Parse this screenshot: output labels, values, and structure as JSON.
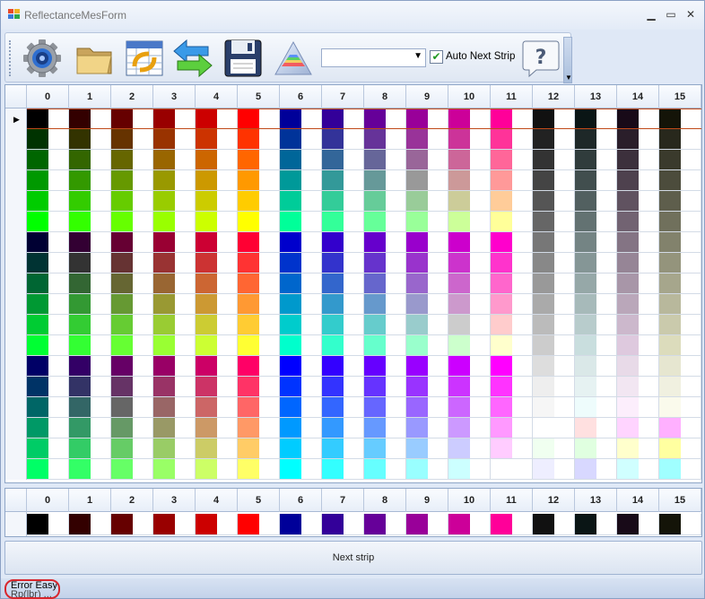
{
  "window": {
    "title": "ReflectanceMesForm",
    "minimize": "▁",
    "maximize": "▭",
    "close": "✕"
  },
  "toolbar": {
    "buttons": [
      {
        "name": "settings-button",
        "icon": "gear-icon"
      },
      {
        "name": "open-folder-button",
        "icon": "folder-icon"
      },
      {
        "name": "table-button",
        "icon": "spreadsheet-refresh-icon"
      },
      {
        "name": "transfer-button",
        "icon": "swap-arrows-icon"
      },
      {
        "name": "save-button",
        "icon": "floppy-disk-icon"
      },
      {
        "name": "prism-button",
        "icon": "prism-icon"
      }
    ],
    "strip_select_value": "",
    "strip_select_arrow": "▼",
    "auto_next_strip_label": "Auto Next Strip",
    "auto_next_strip_checked": true,
    "check_mark": "✔",
    "help_icon": "question-bubble-icon",
    "help_label": "?"
  },
  "grid": {
    "columns": [
      "0",
      "1",
      "2",
      "3",
      "4",
      "5",
      "6",
      "7",
      "8",
      "9",
      "10",
      "11",
      "12",
      "13",
      "14",
      "15"
    ],
    "rows": [
      [
        "#000000",
        "#330000",
        "#660000",
        "#990000",
        "#cc0000",
        "#ff0000",
        "#000099",
        "#330099",
        "#660099",
        "#990099",
        "#cc0099",
        "#ff0099",
        "#111111",
        "#0a1515",
        "#180a18",
        "#141408"
      ],
      [
        "#003300",
        "#333300",
        "#663300",
        "#993300",
        "#cc3300",
        "#ff3300",
        "#003399",
        "#333399",
        "#663399",
        "#993399",
        "#cc3399",
        "#ff3399",
        "#222222",
        "#1e2828",
        "#2a1e2a",
        "#28281c"
      ],
      [
        "#006600",
        "#336600",
        "#666600",
        "#996600",
        "#cc6600",
        "#ff6600",
        "#006699",
        "#336699",
        "#666699",
        "#996699",
        "#cc6699",
        "#ff6699",
        "#333333",
        "#303c3c",
        "#3c303c",
        "#3a3a2c"
      ],
      [
        "#009900",
        "#339900",
        "#669900",
        "#999900",
        "#cc9900",
        "#ff9900",
        "#009999",
        "#339999",
        "#669999",
        "#999999",
        "#cc9999",
        "#ff9999",
        "#444444",
        "#414e4e",
        "#4e414e",
        "#4c4c3c"
      ],
      [
        "#00cc00",
        "#33cc00",
        "#66cc00",
        "#99cc00",
        "#cccc00",
        "#ffcc00",
        "#00cc99",
        "#33cc99",
        "#66cc99",
        "#99cc99",
        "#cccc99",
        "#ffcc99",
        "#555555",
        "#526060",
        "#605260",
        "#5e5e4c"
      ],
      [
        "#00ff00",
        "#33ff00",
        "#66ff00",
        "#99ff00",
        "#ccff00",
        "#ffff00",
        "#00ff99",
        "#33ff99",
        "#66ff99",
        "#99ff99",
        "#ccff99",
        "#ffff99",
        "#666666",
        "#637272",
        "#726372",
        "#70705c"
      ],
      [
        "#000033",
        "#330033",
        "#660033",
        "#990033",
        "#cc0033",
        "#ff0033",
        "#0000cc",
        "#3300cc",
        "#6600cc",
        "#9900cc",
        "#cc00cc",
        "#ff00cc",
        "#777777",
        "#748484",
        "#847484",
        "#82826c"
      ],
      [
        "#003333",
        "#333333",
        "#663333",
        "#993333",
        "#cc3333",
        "#ff3333",
        "#0033cc",
        "#3333cc",
        "#6633cc",
        "#9933cc",
        "#cc33cc",
        "#ff33cc",
        "#888888",
        "#859696",
        "#968596",
        "#94947c"
      ],
      [
        "#006633",
        "#336633",
        "#666633",
        "#996633",
        "#cc6633",
        "#ff6633",
        "#0066cc",
        "#3366cc",
        "#6666cc",
        "#9966cc",
        "#cc66cc",
        "#ff66cc",
        "#999999",
        "#96a8a8",
        "#a896a8",
        "#a6a68c"
      ],
      [
        "#009933",
        "#339933",
        "#669933",
        "#999933",
        "#cc9933",
        "#ff9933",
        "#0099cc",
        "#3399cc",
        "#6699cc",
        "#9999cc",
        "#cc99cc",
        "#ff99cc",
        "#aaaaaa",
        "#a7baba",
        "#baa7ba",
        "#b8b89c"
      ],
      [
        "#00cc33",
        "#33cc33",
        "#66cc33",
        "#99cc33",
        "#cccc33",
        "#ffcc33",
        "#00cccc",
        "#33cccc",
        "#66cccc",
        "#99cccc",
        "#cccccc",
        "#ffcccc",
        "#bbbbbb",
        "#b8cccc",
        "#ccb8cc",
        "#cacaac"
      ],
      [
        "#00ff33",
        "#33ff33",
        "#66ff33",
        "#99ff33",
        "#ccff33",
        "#ffff33",
        "#00ffcc",
        "#33ffcc",
        "#66ffcc",
        "#99ffcc",
        "#ccffcc",
        "#ffffcc",
        "#cccccc",
        "#c9dede",
        "#dec9de",
        "#dcdcbc"
      ],
      [
        "#000066",
        "#330066",
        "#660066",
        "#990066",
        "#cc0066",
        "#ff0066",
        "#0000ff",
        "#3300ff",
        "#6600ff",
        "#9900ff",
        "#cc00ff",
        "#ff00ff",
        "#dddddd",
        "#dae8e8",
        "#e8dae8",
        "#e6e6d0"
      ],
      [
        "#003366",
        "#333366",
        "#663366",
        "#993366",
        "#cc3366",
        "#ff3366",
        "#0033ff",
        "#3333ff",
        "#6633ff",
        "#9933ff",
        "#cc33ff",
        "#ff33ff",
        "#eeeeee",
        "#e6f2f2",
        "#f2e6f2",
        "#f0f0e0"
      ],
      [
        "#006666",
        "#336666",
        "#666666",
        "#996666",
        "#cc6666",
        "#ff6666",
        "#0066ff",
        "#3366ff",
        "#6666ff",
        "#9966ff",
        "#cc66ff",
        "#ff66ff",
        "#f6f6f6",
        "#eefcfc",
        "#fceefc",
        "#fafaec"
      ],
      [
        "#009966",
        "#339966",
        "#669966",
        "#999966",
        "#cc9966",
        "#ff9966",
        "#0099ff",
        "#3399ff",
        "#6699ff",
        "#9999ff",
        "#cc99ff",
        "#ff99ff",
        "#ffffff",
        "#ffe0e0",
        "#ffd4ff",
        "#ffb0ff"
      ],
      [
        "#00cc66",
        "#33cc66",
        "#66cc66",
        "#99cc66",
        "#cccc66",
        "#ffcc66",
        "#00ccff",
        "#33ccff",
        "#66ccff",
        "#99ccff",
        "#ccccff",
        "#ffccff",
        "#f0fff0",
        "#e0ffe0",
        "#ffffcc",
        "#ffffa0"
      ],
      [
        "#00ff66",
        "#33ff66",
        "#66ff66",
        "#99ff66",
        "#ccff66",
        "#ffff66",
        "#00ffff",
        "#33ffff",
        "#66ffff",
        "#99ffff",
        "#ccffff",
        "#ffffff",
        "#eeeeff",
        "#d8d8ff",
        "#d0ffff",
        "#a0ffff"
      ]
    ],
    "selected_row": 0
  },
  "preview": {
    "columns": [
      "0",
      "1",
      "2",
      "3",
      "4",
      "5",
      "6",
      "7",
      "8",
      "9",
      "10",
      "11",
      "12",
      "13",
      "14",
      "15"
    ],
    "colors": [
      "#000000",
      "#330000",
      "#660000",
      "#990000",
      "#cc0000",
      "#ff0000",
      "#000099",
      "#330099",
      "#660099",
      "#990099",
      "#cc0099",
      "#ff0099",
      "#111111",
      "#0a1515",
      "#180a18",
      "#141408"
    ]
  },
  "next_strip_label": "Next strip",
  "status": {
    "line1": "Error Easy",
    "line2": "Rp(lbr) ..."
  }
}
